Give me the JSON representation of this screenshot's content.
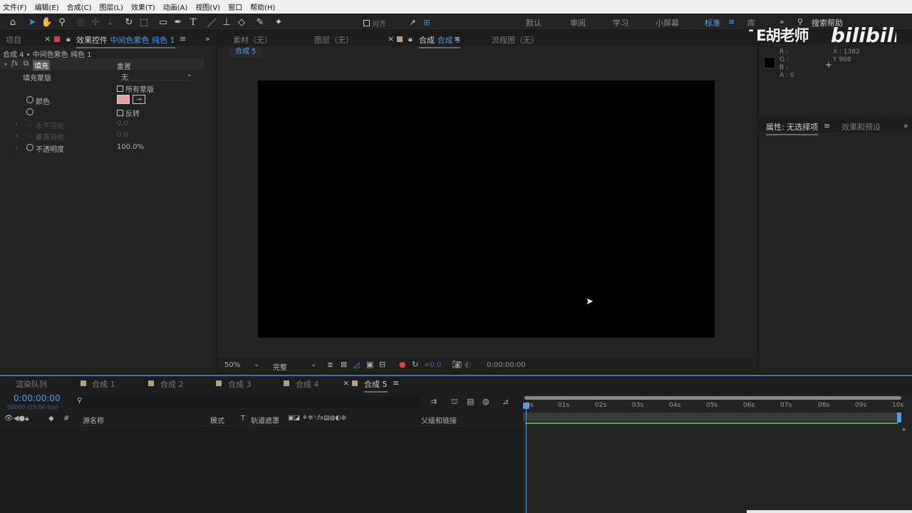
{
  "menubar": [
    "文件(F)",
    "编辑(E)",
    "合成(C)",
    "图层(L)",
    "效果(T)",
    "动画(A)",
    "视图(V)",
    "窗口",
    "帮助(H)"
  ],
  "toolbar": {
    "align_label": "对齐",
    "workspaces": [
      "默认",
      "审阅",
      "学习",
      "小屏幕",
      "标准",
      "库"
    ],
    "active_workspace": "标准",
    "search_placeholder": "搜索帮助"
  },
  "watermark": {
    "text": "AE胡老师"
  },
  "left_panel": {
    "tab_project": "项目",
    "tab_effects_prefix": "效果控件",
    "tab_effects_layer": "中间色紫色 纯色 1",
    "breadcrumb": "合成 4 • 中间色紫色 纯色 1",
    "effect_name": "填充",
    "reset_label": "重置",
    "fill_mask_label": "填充蒙版",
    "fill_mask_value": "无",
    "all_masks_label": "所有蒙版",
    "color_label": "颜色",
    "color_swatch": "#e8a0a8",
    "invert_label": "反转",
    "h_feather_label": "水平羽化",
    "h_feather_value": "0.0",
    "v_feather_label": "垂直羽化",
    "v_feather_value": "0.0",
    "opacity_label": "不透明度",
    "opacity_value": "100.0%"
  },
  "viewer": {
    "tab_footage": "素材（无）",
    "tab_layer": "图层（无）",
    "tab_comp_prefix": "合成",
    "tab_comp_name": "合成 5",
    "tab_flowchart": "流程图（无）",
    "comp_chip": "合成 5",
    "zoom": "50%",
    "resolution": "完整",
    "exposure": "+0.0",
    "timecode": "0:00:00:00"
  },
  "info_panel": {
    "r": "R :",
    "g": "G :",
    "b": "B :",
    "a": "A : 0",
    "x": "X : 1382",
    "y": "Y   908"
  },
  "props_panel": {
    "tab_props": "属性: 无选择项",
    "tab_effects_presets": "效果和预设"
  },
  "timeline": {
    "tabs": [
      "渲染队列",
      "合成 1",
      "合成 2",
      "合成 3",
      "合成 4",
      "合成 5"
    ],
    "active_tab": "合成 5",
    "timecode": "0:00:00:00",
    "timecode_sub": "00000 (25.00 fps)",
    "search_placeholder": "",
    "col_source_name": "源名称",
    "col_mode": "模式",
    "col_t": "T",
    "col_trackmatte": "轨道遮罩",
    "col_parent": "父级和链接",
    "ruler": [
      "0s",
      "01s",
      "02s",
      "03s",
      "04s",
      "05s",
      "06s",
      "07s",
      "08s",
      "09s",
      "10s"
    ]
  }
}
